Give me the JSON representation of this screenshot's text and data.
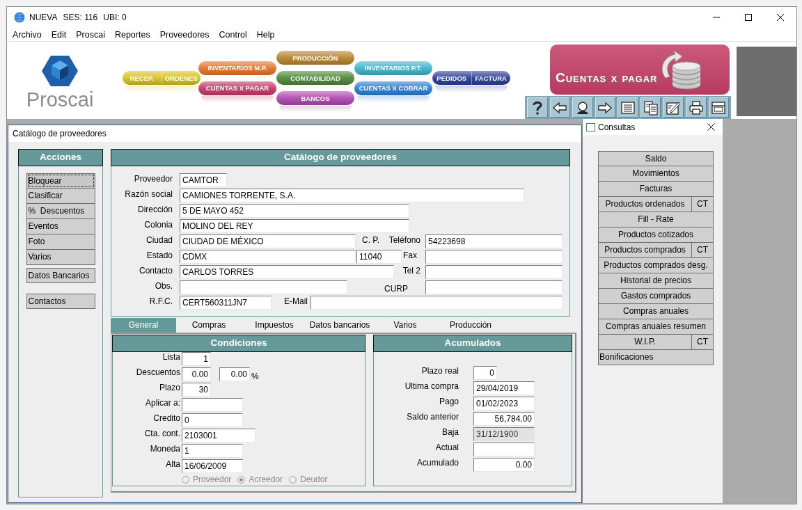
{
  "window": {
    "app": "NUEVA",
    "session": "SES: 116",
    "ubi": "UBI: 0"
  },
  "menu": [
    "Archivo",
    "Edit",
    "Proscai",
    "Reportes",
    "Proveedores",
    "Control",
    "Help"
  ],
  "logo": {
    "text": "Proscai"
  },
  "modules": [
    {
      "pills": [
        {
          "labels": [
            "RECEP.",
            "ORDENES"
          ],
          "color": "#d9c31e"
        }
      ]
    },
    {
      "pills": [
        {
          "labels": [
            "INVENTARIOS M.P."
          ],
          "color": "#e8742a"
        },
        {
          "labels": [
            "CUENTAS X PAGAR"
          ],
          "color": "#c8396a"
        }
      ]
    },
    {
      "pills": [
        {
          "labels": [
            "PRODUCCIÓN"
          ],
          "color": "#b8862e"
        },
        {
          "labels": [
            "CONTABILIDAD"
          ],
          "color": "#4f8a3c"
        },
        {
          "labels": [
            "BANCOS"
          ],
          "color": "#b04ab0"
        }
      ]
    },
    {
      "pills": [
        {
          "labels": [
            "INVENTARIOS P.T."
          ],
          "color": "#3fb6cc"
        },
        {
          "labels": [
            "CUENTAS X COBRAR"
          ],
          "color": "#2a7fd8"
        }
      ]
    },
    {
      "pills": [
        {
          "labels": [
            "PEDIDOS",
            "FACTURA"
          ],
          "color": "#2b3f9a"
        }
      ]
    }
  ],
  "banner": {
    "title": "Cuentas x pagar"
  },
  "catalog_window": {
    "title": "Catálogo de proveedores"
  },
  "actions": {
    "title": "Acciones",
    "groups": [
      [
        {
          "label": "Bloquear",
          "focused": true
        },
        {
          "label": "Clasificar",
          "focused": false
        },
        {
          "label": "%  Descuentos",
          "focused": false
        },
        {
          "label": "Eventos",
          "focused": false
        },
        {
          "label": "Foto",
          "focused": false
        },
        {
          "label": "Varios",
          "focused": false
        }
      ],
      [
        {
          "label": "Datos Bancarios",
          "focused": false
        }
      ],
      [
        {
          "label": "Contactos",
          "focused": false
        }
      ]
    ]
  },
  "supplier": {
    "title": "Catálogo de proveedores",
    "rows": [
      [
        {
          "kind": "label",
          "text": "Proveedor"
        },
        {
          "kind": "field",
          "value": "CAMTOR"
        }
      ],
      [
        {
          "kind": "label",
          "text": "Razón social"
        },
        {
          "kind": "field",
          "value": "CAMIONES TORRENTE, S.A."
        }
      ],
      [
        {
          "kind": "label",
          "text": "Dirección"
        },
        {
          "kind": "field",
          "value": "5 DE MAYO 452"
        }
      ],
      [
        {
          "kind": "label",
          "text": "Colonia"
        },
        {
          "kind": "field",
          "value": "MOLINO DEL REY"
        }
      ],
      [
        {
          "kind": "label",
          "text": "Ciudad"
        },
        {
          "kind": "field",
          "value": "CIUDAD DE MÉXICO"
        },
        {
          "kind": "label",
          "text": "C. P."
        },
        {
          "kind": "label",
          "text": "Teléfono"
        },
        {
          "kind": "field",
          "value": "54223698"
        }
      ],
      [
        {
          "kind": "label",
          "text": "Estado"
        },
        {
          "kind": "field",
          "value": "CDMX"
        },
        {
          "kind": "field",
          "value": "11040"
        },
        {
          "kind": "label",
          "text": "Fax"
        },
        {
          "kind": "field"
        }
      ],
      [
        {
          "kind": "label",
          "text": "Contacto"
        },
        {
          "kind": "field",
          "value": "CARLOS TORRES"
        },
        {
          "kind": "label",
          "text": "Tel 2"
        },
        {
          "kind": "field"
        }
      ],
      [
        {
          "kind": "label",
          "text": "Obs."
        },
        {
          "kind": "field"
        },
        {
          "kind": "label",
          "text": "CURP"
        },
        {
          "kind": "field"
        }
      ],
      [
        {
          "kind": "label",
          "text": "R.F.C."
        },
        {
          "kind": "field",
          "value": "CERT560311JN7"
        },
        {
          "kind": "label",
          "text": "E-Mail"
        },
        {
          "kind": "field"
        }
      ]
    ]
  },
  "tabs": [
    {
      "label": "General",
      "selected": true
    },
    {
      "label": "Compras",
      "selected": false
    },
    {
      "label": "Impuestos",
      "selected": false
    },
    {
      "label": "Datos bancarios",
      "selected": false
    },
    {
      "label": "Varios",
      "selected": false
    },
    {
      "label": "Producción",
      "selected": false
    }
  ],
  "conditions": {
    "title": "Condiciones",
    "rows": [
      {
        "label": "Lista",
        "fields": [
          {
            "kind": "number",
            "value": "1"
          }
        ]
      },
      {
        "label": "Descuentos",
        "fields": [
          {
            "kind": "number",
            "value": "0.00"
          },
          {
            "kind": "number",
            "value": "0.00"
          }
        ],
        "unit": "%"
      },
      {
        "label": "Plazo",
        "fields": [
          {
            "kind": "number",
            "value": "30"
          }
        ]
      },
      {
        "label": "Aplicar a:",
        "fields": [
          {
            "kind": "text"
          }
        ]
      },
      {
        "label": "Credito",
        "fields": [
          {
            "kind": "text",
            "value": "0"
          }
        ]
      },
      {
        "label": "Cta. cont.",
        "fields": [
          {
            "kind": "text",
            "value": "2103001"
          }
        ]
      },
      {
        "label": "Moneda",
        "fields": [
          {
            "kind": "text",
            "value": "1"
          }
        ]
      },
      {
        "label": "Alta",
        "fields": [
          {
            "kind": "text",
            "value": "16/06/2009"
          }
        ]
      }
    ],
    "radios": {
      "disabled": true,
      "options": [
        {
          "label": "Proveedor",
          "selected": false
        },
        {
          "label": "Acreedor",
          "selected": true
        },
        {
          "label": "Deudor",
          "selected": false
        }
      ]
    }
  },
  "accumulated": {
    "title": "Acumulados",
    "rows": [
      {
        "label": "Plazo real",
        "kind": "number",
        "value": "0",
        "disabled": false
      },
      {
        "label": "Ultima compra",
        "kind": "text",
        "value": "29/04/2019",
        "disabled": false
      },
      {
        "label": "Pago",
        "kind": "text",
        "value": "01/02/2023",
        "disabled": false
      },
      {
        "label": "Saldo anterior",
        "kind": "number",
        "value": "56,784.00",
        "disabled": false
      },
      {
        "label": "Baja",
        "kind": "text",
        "value": "31/12/1900",
        "disabled": true
      },
      {
        "label": "Actual",
        "kind": "text",
        "disabled": false
      },
      {
        "label": "Acumulado",
        "kind": "number",
        "value": "0.00",
        "disabled": false
      }
    ]
  },
  "consultas": {
    "title": "Consultas",
    "items": [
      {
        "kind": "button",
        "label": "Saldo"
      },
      {
        "kind": "button",
        "label": "Movimientos"
      },
      {
        "kind": "button",
        "label": "Facturas"
      },
      {
        "kind": "split",
        "label": "Productos ordenados",
        "extra": "CT"
      },
      {
        "kind": "button",
        "label": "Fill - Rate"
      },
      {
        "kind": "button",
        "label": "Productos cotizados"
      },
      {
        "kind": "split",
        "label": "Productos comprados",
        "extra": "CT"
      },
      {
        "kind": "button",
        "label": "Productos comprados desg."
      },
      {
        "kind": "button",
        "label": "Historial de precios"
      },
      {
        "kind": "button",
        "label": "Gastos comprados"
      },
      {
        "kind": "button",
        "label": "Compras anuales"
      },
      {
        "kind": "button",
        "label": "Compras anuales resumen"
      },
      {
        "kind": "split",
        "label": "W.I.P.",
        "extra": "CT"
      },
      {
        "kind": "flush",
        "label": "Bonificaciones"
      }
    ]
  }
}
